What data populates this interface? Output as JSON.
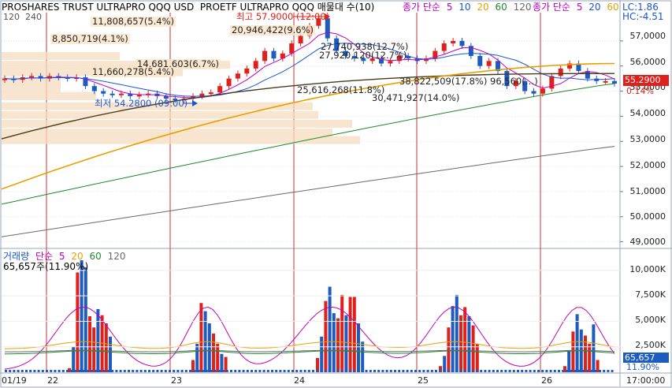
{
  "header": {
    "title": "PROSHARES TRUST ULTRAPRO QQQ USD",
    "subtitle": "PROETF ULTRAPRO QQQ 매물대 수(10)",
    "ma_label": "종가 단순",
    "ma_periods": [
      "5",
      "10",
      "20",
      "60",
      "120"
    ],
    "ma_label2": "종가 단순",
    "ma_periods2": [
      "5",
      "20",
      "60"
    ],
    "top_left_periods": [
      "120",
      "240"
    ],
    "lc": "LC:1.86",
    "hc": "HC:-4.51"
  },
  "price_axis": {
    "ticks": [
      "57,0000",
      "56,0000",
      "55,0000",
      "54,0000",
      "53,0000",
      "52,0000",
      "51,0000",
      "50,0000",
      "49,0000"
    ],
    "current_price": "55.2900",
    "change_pct": "0.14%"
  },
  "volume_pane": {
    "legend_label": "거래량",
    "legend_ma": "단순",
    "legend_periods": [
      "5",
      "20",
      "60",
      "120"
    ],
    "current_label": "65,657주(11.90%)",
    "ticks": [
      "10,000K",
      "7,500K",
      "5,000K",
      "2,500K"
    ],
    "current_value": "65,657",
    "current_pct": "11.90%"
  },
  "annotations": {
    "high": "최고 57.9000 (12:00)",
    "low": "최저 54.2800 (09:00)",
    "profile": [
      "11,808,657(5.4%)",
      "20,946,422(9.6%)",
      "8,850,719(4.1%)",
      "27,740,938(12.7%)",
      "27,920,120(12.7%)",
      "14,681,603(6.7%)",
      "11,660,278(5.4%)",
      "38,822,509(17.8%)",
      "96,560(…)",
      "25,616,268(11.8%)",
      "30,471,927(14.0%)"
    ]
  },
  "x_axis": {
    "dates": [
      "01/19",
      "22",
      "23",
      "24",
      "25",
      "26"
    ],
    "time_end": "17:00:00"
  },
  "colors": {
    "up": "#e0201a",
    "down": "#1e5bbf",
    "ma5": "#c000c0",
    "ma10": "#1a55d8",
    "ma20": "#e8a000",
    "ma60": "#1f8a2a",
    "ma120": "#6a6a6a",
    "ma_dark": "#4a3a1a",
    "session_line": "#c8343a",
    "profile": "#f6dcc0"
  },
  "chart_data": {
    "type": "candlestick",
    "series": [
      {
        "name": "종가",
        "values": [
          55.5,
          55.45,
          55.55,
          55.6,
          55.5,
          55.6,
          55.55,
          55.5,
          55.55,
          55.2,
          55.0,
          54.9,
          54.85,
          54.9,
          54.8,
          54.85,
          54.9,
          54.8,
          54.7,
          54.65,
          54.7,
          54.8,
          54.9,
          54.95,
          55.2,
          55.5,
          55.7,
          55.9,
          56.2,
          56.6,
          56.3,
          56.5,
          56.9,
          57.2,
          57.6,
          57.9,
          57.1,
          56.6,
          56.4,
          56.3,
          56.2,
          56.3,
          56.1,
          56.2,
          56.4,
          56.3,
          56.2,
          56.3,
          56.6,
          56.9,
          57.0,
          56.8,
          56.4,
          56.0,
          56.2,
          55.8,
          55.2,
          55.4,
          55.0,
          54.9,
          55.1,
          55.6,
          55.9,
          56.1,
          55.8,
          55.5,
          55.4,
          55.4,
          55.3
        ]
      }
    ],
    "x": [
      "01/19",
      "22",
      "23",
      "24",
      "25",
      "26"
    ],
    "ylim": [
      48.8,
      58.0
    ],
    "volume": {
      "ylim": [
        0,
        11000
      ],
      "unit": "K"
    }
  }
}
